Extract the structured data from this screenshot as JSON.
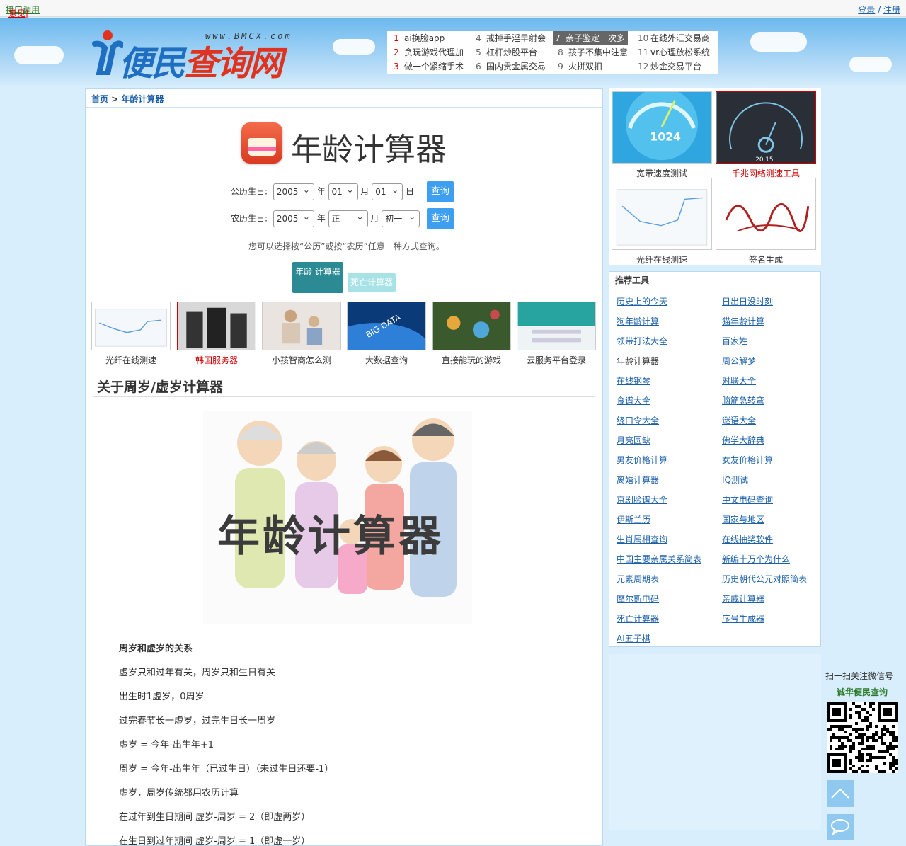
{
  "topbar": {
    "api_link": "接口调用",
    "feedback_link": "意见|报错",
    "login": "登录",
    "sep": " / ",
    "register": "注册"
  },
  "logo": {
    "url_text": "www.BMCX.com",
    "name_part1": "便民",
    "name_part2": "查询网"
  },
  "hot_list": [
    {
      "n": "1",
      "t": "ai换脸app"
    },
    {
      "n": "2",
      "t": "贪玩游戏代理加"
    },
    {
      "n": "3",
      "t": "做一个紧缩手术"
    },
    {
      "n": "4",
      "t": "戒掉手淫早射会"
    },
    {
      "n": "5",
      "t": "杠杆炒股平台"
    },
    {
      "n": "6",
      "t": "国内贵金属交易"
    },
    {
      "n": "7",
      "t": "亲子鉴定一次多"
    },
    {
      "n": "8",
      "t": "孩子不集中注意"
    },
    {
      "n": "9",
      "t": "火拼双扣"
    },
    {
      "n": "10",
      "t": "在线外汇交易商"
    },
    {
      "n": "11",
      "t": "vr心理放松系统"
    },
    {
      "n": "12",
      "t": "炒金交易平台"
    }
  ],
  "breadcrumb": {
    "home": "首页",
    "sep": " > ",
    "current": "年龄计算器"
  },
  "page_title": "年龄计算器",
  "form": {
    "solar_label": "公历生日:",
    "solar_year": "2005",
    "solar_month": "01",
    "solar_day": "01",
    "lunar_label": "农历生日:",
    "lunar_year": "2005",
    "lunar_month": "正",
    "lunar_day": "初一",
    "unit_year": "年",
    "unit_month": "月",
    "unit_day": "日",
    "query_btn": "查询",
    "hint": "您可以选择按“公历”或按“农历”任意一种方式查询。"
  },
  "tabs": {
    "age": "年龄 计算器",
    "death": "死亡计算器"
  },
  "thumbs": [
    "光纤在线测速",
    "韩国服务器",
    "小孩智商怎么测",
    "大数据查询",
    "直接能玩的游戏",
    "云服务平台登录"
  ],
  "thumb_texts": {
    "big_data": "BIG DATA"
  },
  "section_title": "关于周岁/虚岁计算器",
  "illustration_title": "年龄计算器",
  "article": [
    "周岁和虚岁的关系",
    "虚岁只和过年有关，周岁只和生日有关",
    "出生时1虚岁，0周岁",
    "过完春节长一虚岁，过完生日长一周岁",
    "虚岁 = 今年-出生年+1",
    "周岁 = 今年-出生年（已过生日）（未过生日还要-1）",
    "虚岁，周岁传统都用农历计算",
    "在过年到生日期间 虚岁-周岁 = 2（即虚两岁）",
    "在生日到过年期间 虚岁-周岁 = 1（即虚一岁）"
  ],
  "right_ads": [
    "宽带速度测试",
    "千兆网络测速工具",
    "光纤在线测速",
    "签名生成"
  ],
  "speed_texts": {
    "value": "1024",
    "gauge_center": "20.15"
  },
  "tools_title": "推荐工具",
  "tools": [
    "历史上的今天",
    "日出日没时刻",
    "狗年龄计算",
    "猫年龄计算",
    "领带打法大全",
    "百家姓",
    "年龄计算器",
    "周公解梦",
    "在线钢琴",
    "对联大全",
    "食谱大全",
    "脑筋急转弯",
    "绕口令大全",
    "谜语大全",
    "月亮圆缺",
    "佛学大辞典",
    "男友价格计算",
    "女友价格计算",
    "离婚计算器",
    "IQ测试",
    "京剧脸谱大全",
    "中文电码查询",
    "伊斯兰历",
    "国家与地区",
    "生肖属相查询",
    "在线抽奖软件",
    "中国主要亲属关系简表",
    "新编十万个为什么",
    "元素周期表",
    "历史朝代公元对照简表",
    "摩尔斯电码",
    "亲戚计算器",
    "死亡计算器",
    "序号生成器",
    "AI五子棋"
  ],
  "wechat": {
    "line1": "扫一扫关注微信号",
    "line2": "诚华便民查询"
  },
  "colors": {
    "accent": "#3e9ff0",
    "link": "#1a5fa8",
    "teal": "#2b8a93",
    "red": "#cc0000"
  }
}
